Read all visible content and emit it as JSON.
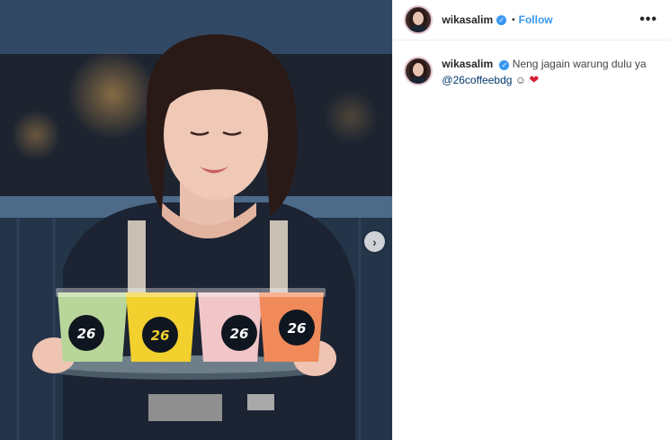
{
  "post": {
    "username": "wikasalim",
    "verified_icon": "verified-badge-icon",
    "separator": "•",
    "follow_label": "Follow",
    "more_label": "•••",
    "next_arrow": "›",
    "caption": {
      "username": "wikasalim",
      "text_before": "Neng jagain warung dulu ya ",
      "mention": "@26coffeebdg",
      "emoji_smile": "☺",
      "emoji_heart": "❤"
    },
    "cup_logo_text": "26"
  },
  "colors": {
    "accent_blue": "#3897f0",
    "cup_green": "#b9d69a",
    "cup_yellow": "#f2d02e",
    "cup_pink": "#f1c6c9",
    "cup_orange": "#f08a5a"
  }
}
